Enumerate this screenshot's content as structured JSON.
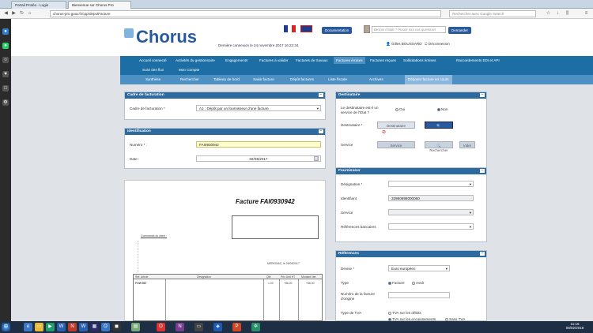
{
  "browser": {
    "tabs": [
      "Portail Protéo - Login",
      "Bienvenue sur Chorus Pro"
    ],
    "url": "chorus-pro.gouv.fr/cpp/depotFacture",
    "search_placeholder": "Rechercher avec Google Search"
  },
  "header": {
    "logo": "Chorus",
    "logo_sub": "Pro",
    "last_connection": "Dernière connexion le 24 novembre 2017 16:22:34",
    "documentation": "Documentation",
    "help_placeholder": "Besoin d'aide ? Posez-moi vos questions",
    "ask": "Demander",
    "user": "Gilles BOUSSARD",
    "logout": "Déconnexion"
  },
  "menu1": [
    "Accueil connecté",
    "Activités du gestionnaire",
    "Engagements",
    "Factures à valider",
    "Factures de travaux",
    "Factures émises",
    "Factures reçues",
    "Sollicitations émises",
    "Raccordements EDI et API"
  ],
  "menu1b": [
    "Suivi des flux",
    "Mon Compte"
  ],
  "menu2": [
    "Synthèse",
    "Rechercher",
    "Tableau de bord",
    "Saisir facture",
    "Dépôt factures",
    "Liste fiscale",
    "Archives",
    "Déposer facture en cours"
  ],
  "cadre": {
    "title": "Cadre de facturation",
    "label": "Cadre de facturation *",
    "value": "A1 : Dépôt par un fournisseur d'une facture"
  },
  "identification": {
    "title": "Identification",
    "numero_label": "Numéro * :",
    "numero": "FAI0930942",
    "date_label": "Date :",
    "date": "02/06/2017"
  },
  "invoice": {
    "title": "Facture",
    "number": "FAI0930942",
    "client_label": "Commande du client :",
    "col_ref": "Réf. Article",
    "col_desig": "Désignation",
    "col_qty": "Qté",
    "col_pu": "Prix Unit HT",
    "col_ht": "Montant Net",
    "row_ref": "FOW 867",
    "row_qty": "1.00",
    "row_pu": "+86,00",
    "row_ht": "+86,00",
    "place_date": "MERIGNAC, le 26/04/2017"
  },
  "destinataire": {
    "title": "Destinataire",
    "etat_label": "Le destinataire est-il un service de l'Etat ?",
    "oui": "Oui",
    "non": "Non",
    "dest_label": "Destinataire *",
    "dest_placeholder": "Destinataire",
    "rechercher": "Rechercher",
    "service_label": "Service",
    "service_placeholder": "Service",
    "rechercher2": "Rechercher",
    "vider": "Vider"
  },
  "fournisseur": {
    "title": "Fournisseur",
    "designation_label": "Désignation *",
    "identifiant_label": "Identifiant",
    "identifiant": "33960698000060",
    "service_label": "Service",
    "ref_label": "Références bancaires"
  },
  "references": {
    "title": "Références",
    "devise_label": "Devise *",
    "devise": "Euro européen",
    "type_label": "Type",
    "facture": "Facture",
    "avoir": "Avoir",
    "numero_label": "Numéro de la facture d'origine",
    "tva_label": "Type de TVA",
    "tva1": "TVA sur les débits",
    "tva2": "TVA sur les encaissements",
    "tva3": "Sans TVA"
  },
  "taskbar": {
    "time": "11:16",
    "date": "08/02/2018"
  }
}
